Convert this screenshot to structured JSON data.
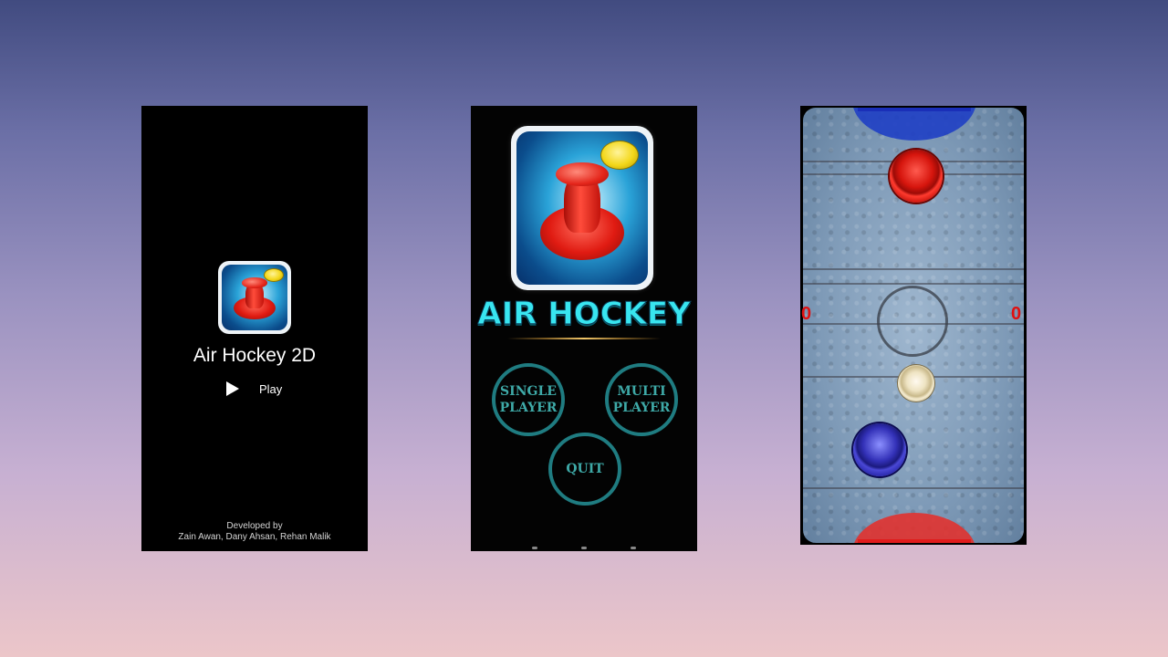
{
  "splash": {
    "title": "Air Hockey 2D",
    "play_label": "Play",
    "developed_by": "Developed by",
    "developers": "Zain Awan, Dany Ahsan, Rehan Malik"
  },
  "menu": {
    "logo": "AIR HOCKEY",
    "single_line1": "SINGLE",
    "single_line2": "PLAYER",
    "multi_line1": "MULTI",
    "multi_line2": "PLAYER",
    "quit": "QUIT"
  },
  "game": {
    "score_left": "0",
    "score_right": "0",
    "colors": {
      "player1": "#d6150d",
      "player2": "#3331b8",
      "goal_top": "#1f3fc4",
      "goal_bottom": "#e1322f"
    }
  }
}
